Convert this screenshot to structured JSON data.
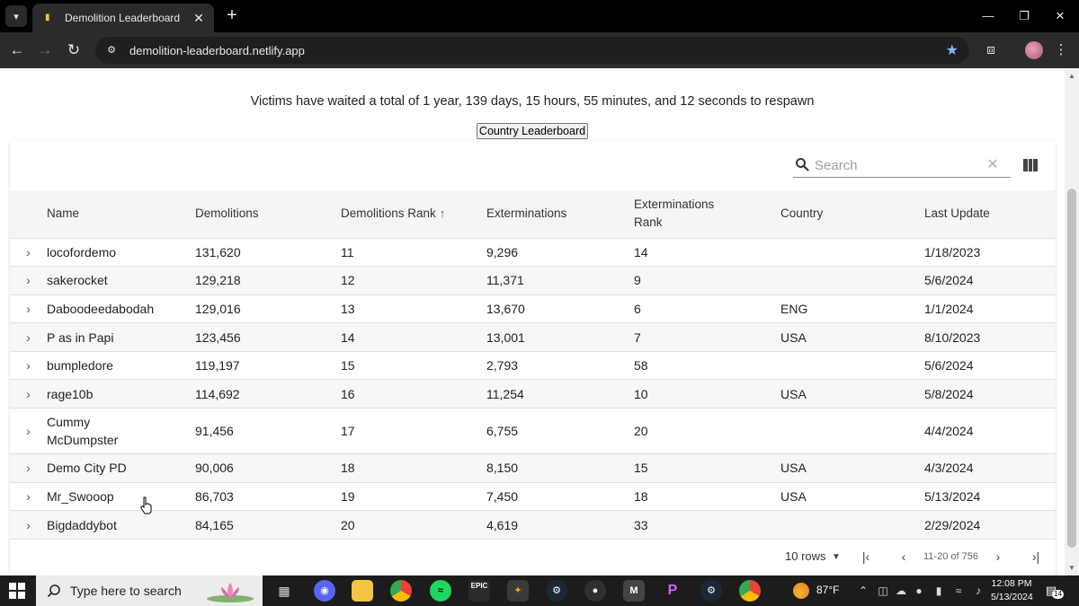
{
  "browser": {
    "tab_title": "Demolition Leaderboard",
    "url": "demolition-leaderboard.netlify.app"
  },
  "page": {
    "respawn_text": "Victims have waited a total of 1 year, 139 days, 15 hours, 55 minutes, and 12 seconds to respawn",
    "country_button": "Country Leaderboard",
    "search": {
      "placeholder": "Search"
    }
  },
  "table": {
    "columns": {
      "name": "Name",
      "demolitions": "Demolitions",
      "demolitions_rank": "Demolitions Rank",
      "exterminations": "Exterminations",
      "exterminations_rank": "Exterminations Rank",
      "country": "Country",
      "last_update": "Last Update"
    },
    "sort": {
      "column": "demolitions_rank",
      "direction": "ascending"
    },
    "rows": [
      {
        "name": "locofordemo",
        "demolitions": "131,620",
        "demolitions_rank": "11",
        "exterminations": "9,296",
        "exterminations_rank": "14",
        "country": "",
        "last_update": "1/18/2023"
      },
      {
        "name": "sakerocket",
        "demolitions": "129,218",
        "demolitions_rank": "12",
        "exterminations": "11,371",
        "exterminations_rank": "9",
        "country": "",
        "last_update": "5/6/2024"
      },
      {
        "name": "Daboodeedabodah",
        "demolitions": "129,016",
        "demolitions_rank": "13",
        "exterminations": "13,670",
        "exterminations_rank": "6",
        "country": "ENG",
        "last_update": "1/1/2024"
      },
      {
        "name": "P as in Papi",
        "demolitions": "123,456",
        "demolitions_rank": "14",
        "exterminations": "13,001",
        "exterminations_rank": "7",
        "country": "USA",
        "last_update": "8/10/2023"
      },
      {
        "name": "bumpledore",
        "demolitions": "119,197",
        "demolitions_rank": "15",
        "exterminations": "2,793",
        "exterminations_rank": "58",
        "country": "",
        "last_update": "5/6/2024"
      },
      {
        "name": "rage10b",
        "demolitions": "114,692",
        "demolitions_rank": "16",
        "exterminations": "11,254",
        "exterminations_rank": "10",
        "country": "USA",
        "last_update": "5/8/2024"
      },
      {
        "name": "Cummy McDumpster",
        "demolitions": "91,456",
        "demolitions_rank": "17",
        "exterminations": "6,755",
        "exterminations_rank": "20",
        "country": "",
        "last_update": "4/4/2024"
      },
      {
        "name": "Demo City PD",
        "demolitions": "90,006",
        "demolitions_rank": "18",
        "exterminations": "8,150",
        "exterminations_rank": "15",
        "country": "USA",
        "last_update": "4/3/2024"
      },
      {
        "name": "Mr_Swooop",
        "demolitions": "86,703",
        "demolitions_rank": "19",
        "exterminations": "7,450",
        "exterminations_rank": "18",
        "country": "USA",
        "last_update": "5/13/2024"
      },
      {
        "name": "Bigdaddybot",
        "demolitions": "84,165",
        "demolitions_rank": "20",
        "exterminations": "4,619",
        "exterminations_rank": "33",
        "country": "",
        "last_update": "2/29/2024"
      }
    ]
  },
  "pagination": {
    "rows_per_page": "10 rows",
    "info": "11-20 of 756"
  },
  "taskbar": {
    "search_placeholder": "Type here to search",
    "temperature": "87°F",
    "time": "12:08 PM",
    "date": "5/13/2024",
    "notification_count": "14",
    "apps": [
      "task-view",
      "discord",
      "file-explorer",
      "chrome",
      "spotify",
      "epic-games",
      "app-7",
      "steam",
      "obs",
      "app-10",
      "picsart",
      "steam-2",
      "chrome-2"
    ]
  }
}
